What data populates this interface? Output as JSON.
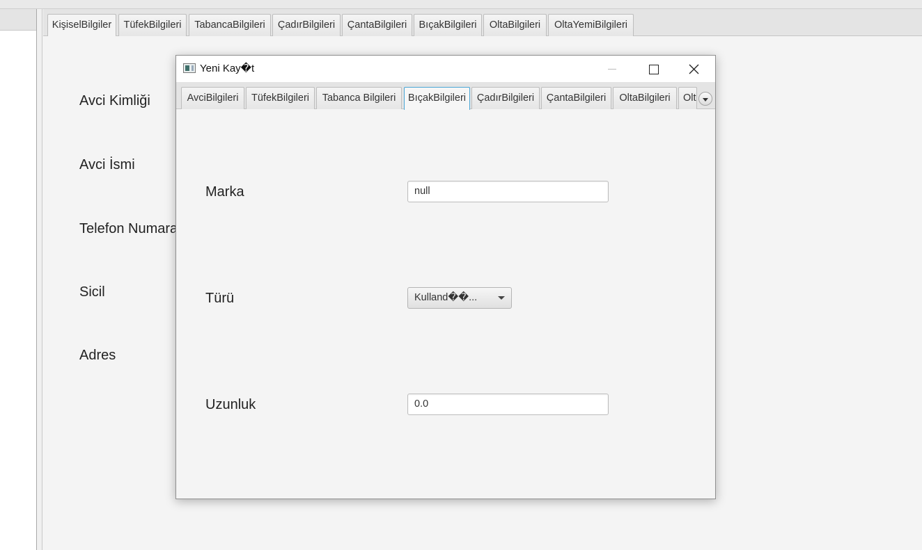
{
  "main": {
    "tabs": [
      {
        "label": "KişiselBilgiler"
      },
      {
        "label": "TüfekBilgileri"
      },
      {
        "label": "TabancaBilgileri"
      },
      {
        "label": "ÇadırBilgileri"
      },
      {
        "label": "ÇantaBilgileri"
      },
      {
        "label": "BıçakBilgileri"
      },
      {
        "label": "OltaBilgileri"
      },
      {
        "label": "OltaYemiBilgileri"
      }
    ],
    "selected_tab": "KişiselBilgiler",
    "labels": [
      "Avci Kimliği",
      "Avci İsmi",
      "Telefon Numara",
      "Sicil",
      "Adres"
    ]
  },
  "dialog": {
    "title": "Yeni Kay�t",
    "tabs": [
      {
        "label": "AvciBilgileri"
      },
      {
        "label": "TüfekBilgileri"
      },
      {
        "label": "Tabanca Bilgileri"
      },
      {
        "label": "BıçakBilgileri"
      },
      {
        "label": "ÇadırBilgileri"
      },
      {
        "label": "ÇantaBilgileri"
      },
      {
        "label": "OltaBilgileri"
      },
      {
        "label": "Olt"
      }
    ],
    "selected_tab": "BıçakBilgileri",
    "form": {
      "marka_label": "Marka",
      "marka_value": "null",
      "turu_label": "Türü",
      "turu_value": "Kulland��...",
      "uzunluk_label": "Uzunluk",
      "uzunluk_value": "0.0"
    }
  },
  "colors": {
    "selected_tab_border": "#49a6d6",
    "background": "#f4f4f4"
  },
  "icons": {
    "app": "app-window-icon",
    "minimize": "minimize-icon",
    "maximize": "maximize-icon",
    "close": "close-icon",
    "tab_overflow": "chevron-down-icon",
    "combo_arrow": "caret-down-icon"
  }
}
